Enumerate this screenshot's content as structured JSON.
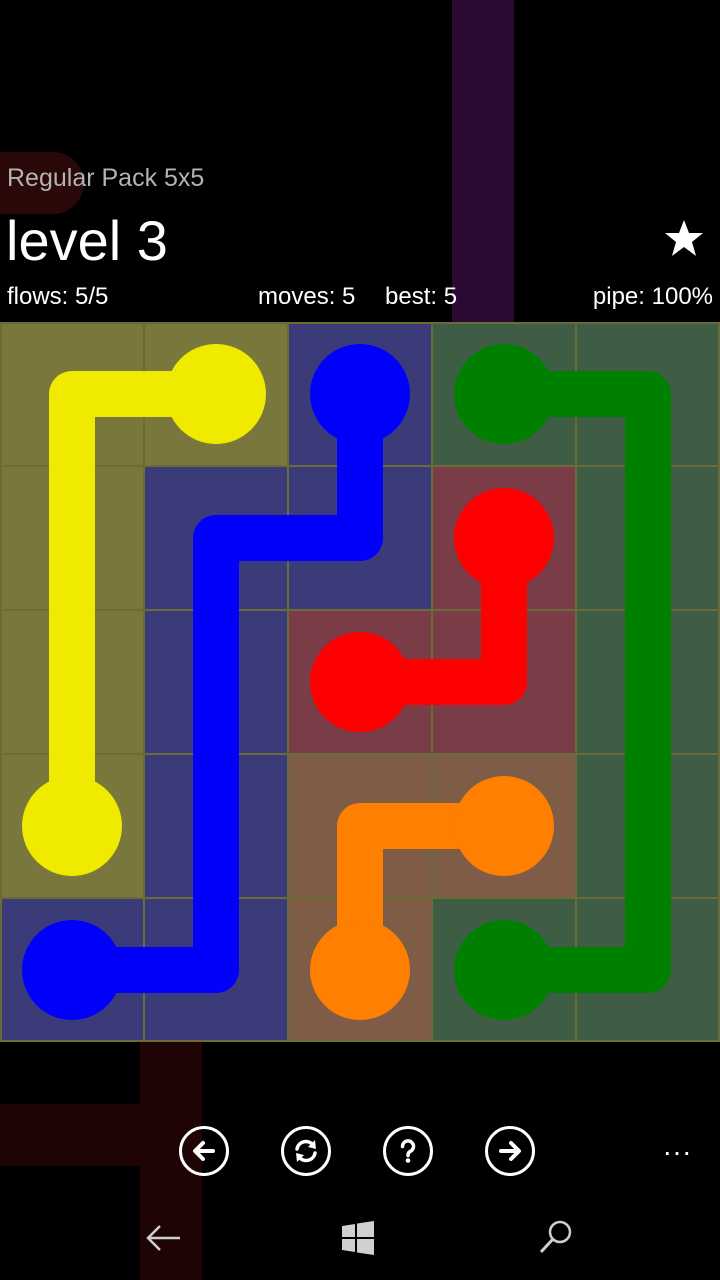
{
  "header": {
    "pack_title": "Regular Pack 5x5",
    "level_title": "level 3",
    "star_icon": "star-icon"
  },
  "stats": {
    "flows": "flows: 5/5",
    "moves": "moves: 5",
    "best": "best: 5",
    "pipe": "pipe: 100%"
  },
  "board": {
    "size": 5,
    "colors": {
      "yellow": "#efea00",
      "blue": "#0000fb",
      "green": "#008000",
      "red": "#fe0000",
      "orange": "#ff7f00"
    },
    "cell_fill_colors": {
      "yellow": "#7a773c",
      "blue": "#3b3b7a",
      "green": "#3f5c44",
      "red": "#7a3c46",
      "orange": "#7e5c46"
    },
    "grid_line_color": "#6b6b38",
    "flows": [
      {
        "color": "yellow",
        "path": [
          [
            0,
            1
          ],
          [
            0,
            0
          ],
          [
            1,
            0
          ],
          [
            2,
            0
          ],
          [
            3,
            0
          ]
        ]
      },
      {
        "color": "blue",
        "path": [
          [
            0,
            2
          ],
          [
            1,
            2
          ],
          [
            1,
            1
          ],
          [
            2,
            1
          ],
          [
            3,
            1
          ],
          [
            4,
            1
          ],
          [
            4,
            0
          ]
        ]
      },
      {
        "color": "green",
        "path": [
          [
            0,
            3
          ],
          [
            0,
            4
          ],
          [
            1,
            4
          ],
          [
            2,
            4
          ],
          [
            3,
            4
          ],
          [
            4,
            4
          ],
          [
            4,
            3
          ]
        ]
      },
      {
        "color": "red",
        "path": [
          [
            1,
            3
          ],
          [
            2,
            3
          ],
          [
            2,
            2
          ]
        ]
      },
      {
        "color": "orange",
        "path": [
          [
            3,
            3
          ],
          [
            3,
            2
          ],
          [
            4,
            2
          ]
        ]
      }
    ]
  },
  "controls": {
    "prev_icon": "arrow-left-icon",
    "restart_icon": "restart-icon",
    "hint_icon": "help-icon",
    "next_icon": "arrow-right-icon",
    "more_label": "..."
  },
  "system_nav": {
    "back_icon": "back-icon",
    "home_icon": "windows-icon",
    "search_icon": "search-icon"
  }
}
